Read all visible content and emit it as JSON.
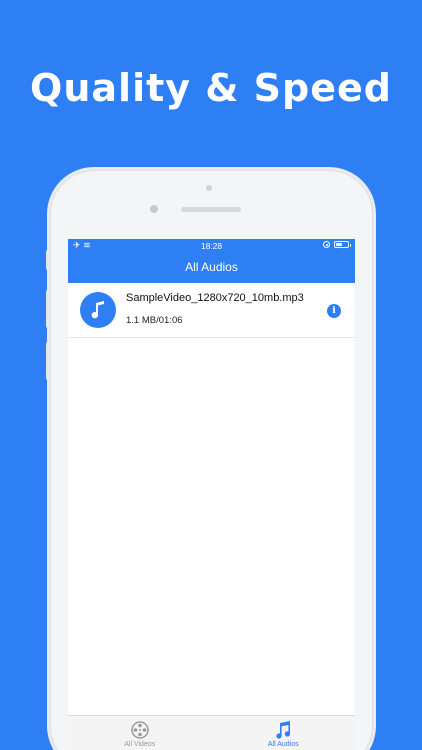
{
  "headline": "Quality & Speed",
  "status_bar": {
    "time": "18:28",
    "airplane": "✈",
    "wifi": "≋",
    "battery_level": 0.55
  },
  "nav": {
    "title": "All Audios"
  },
  "audios": [
    {
      "name": "SampleVideo_1280x720_10mb.mp3",
      "meta": "1.1 MB/01:06",
      "info": "i"
    }
  ],
  "tabs": [
    {
      "label": "All Videos",
      "icon": "film-reel-icon",
      "active": false
    },
    {
      "label": "All Audios",
      "icon": "music-note-icon",
      "active": true
    }
  ],
  "colors": {
    "accent": "#2f7ff4",
    "inactive": "#9a9a9a"
  }
}
